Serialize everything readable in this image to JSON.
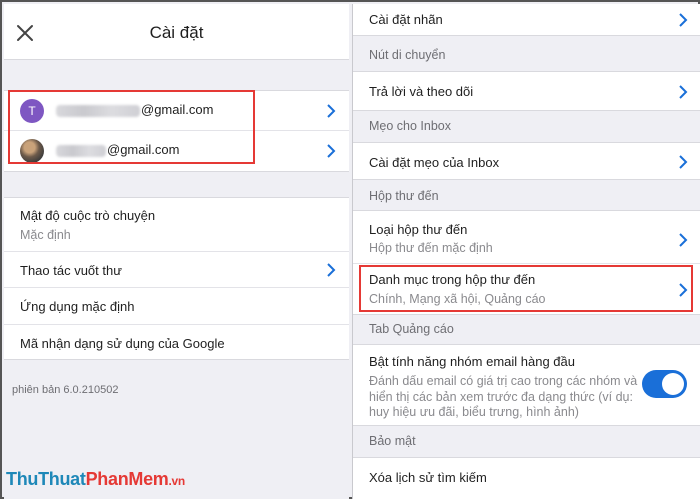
{
  "left": {
    "title": "Cài đặt",
    "close_icon": "close-icon",
    "accounts": [
      {
        "avatar_letter": "T",
        "avatar_color": "#7e57c2",
        "email_domain": "@gmail.com"
      },
      {
        "avatar_letter": "",
        "email_domain": "@gmail.com"
      }
    ],
    "settings": [
      {
        "title": "Mật độ cuộc trò chuyện",
        "subtitle": "Mặc định"
      },
      {
        "title": "Thao tác vuốt thư"
      },
      {
        "title": "Ứng dụng mặc định"
      },
      {
        "title": "Mã nhận dạng sử dụng của Google"
      }
    ],
    "version": "phiên bản 6.0.210502"
  },
  "right": {
    "top_item": "Cài đặt nhãn",
    "section_swipe": "Nút di chuyển",
    "reply_follow": "Trả lời và theo dõi",
    "section_tips": "Mẹo cho Inbox",
    "tips_settings": "Cài đặt mẹo của Inbox",
    "section_inbox": "Hộp thư đến",
    "inbox_type_title": "Loại hộp thư đến",
    "inbox_type_value": "Hộp thư đến mặc định",
    "inbox_categories_title": "Danh mục trong hộp thư đến",
    "inbox_categories_value": "Chính, Mạng xã hội, Quảng cáo",
    "section_promo": "Tab Quảng cáo",
    "promo_title": "Bật tính năng nhóm email hàng đầu",
    "promo_desc": "Đánh dấu email có giá trị cao trong các nhóm và hiển thị các bản xem trước đa dạng thức (ví dụ: huy hiệu ưu đãi, biểu trưng, hình ảnh)",
    "promo_toggle_on": true,
    "section_security": "Bảo mật",
    "clear_search": "Xóa lịch sử tìm kiếm"
  },
  "watermark": {
    "part1": "ThuThuat",
    "part2": "PhanMem",
    "part3": ".vn"
  },
  "colors": {
    "accent": "#1a6fd8",
    "highlight": "#e53935",
    "chevron": "#1a6fd8"
  }
}
